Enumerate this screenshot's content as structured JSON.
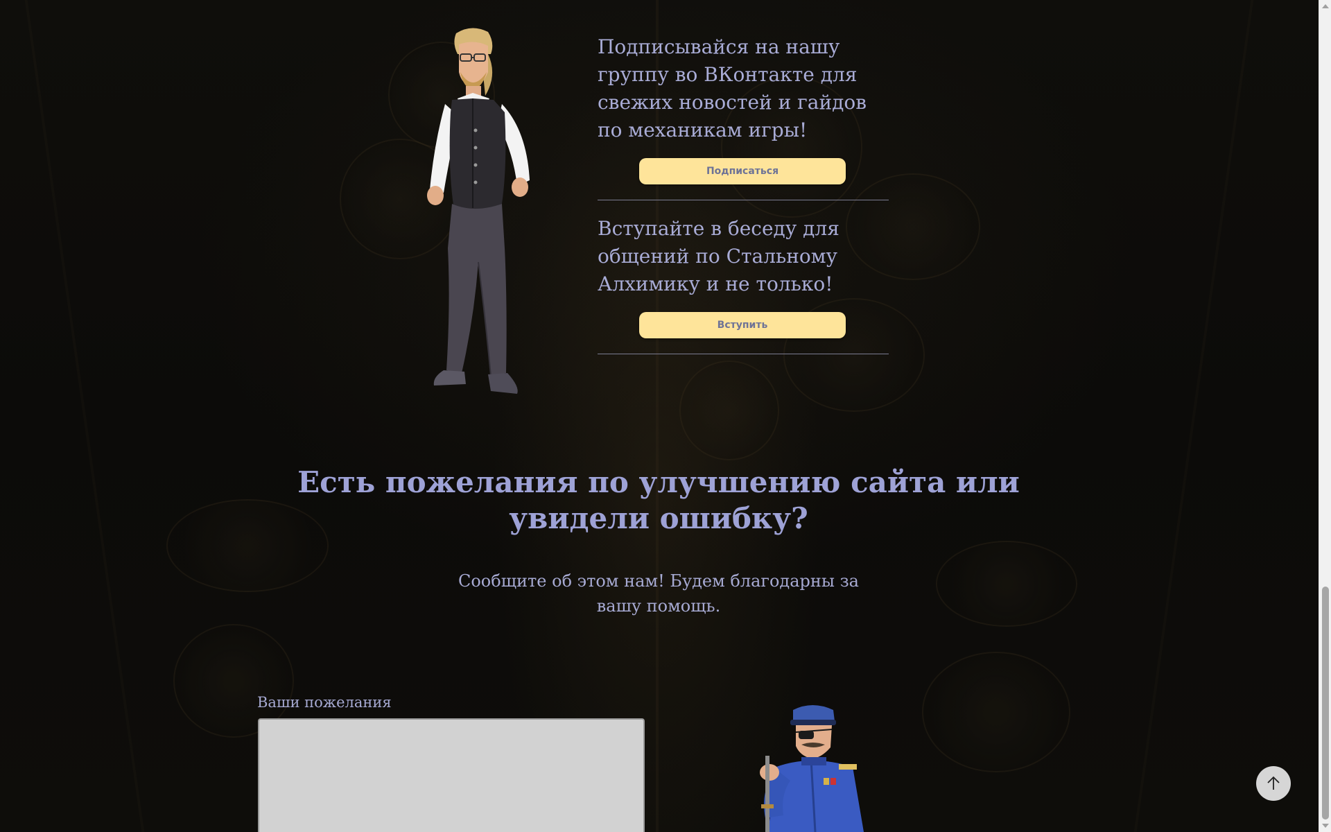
{
  "community": {
    "group_text": "Подписывайся на нашу группу во ВКонтакте для свежих новостей и гайдов по механикам игры!",
    "subscribe_label": "Подписаться",
    "chat_text": "Вступайте в беседу для общений по Стальному Алхимику и не только!",
    "join_label": "Вступить"
  },
  "feedback": {
    "title": "Есть пожелания по улучшению сайта или увидели ошибку?",
    "subtitle": "Сообщите об этом нам! Будем благодарны за вашу помощь.",
    "field_label": "Ваши пожелания",
    "field_value": ""
  },
  "icons": {
    "scroll_top": "arrow-up-icon"
  },
  "colors": {
    "button_bg": "#fee49a",
    "text_accent": "#9ea2d6",
    "page_bg": "#0c0b09"
  }
}
